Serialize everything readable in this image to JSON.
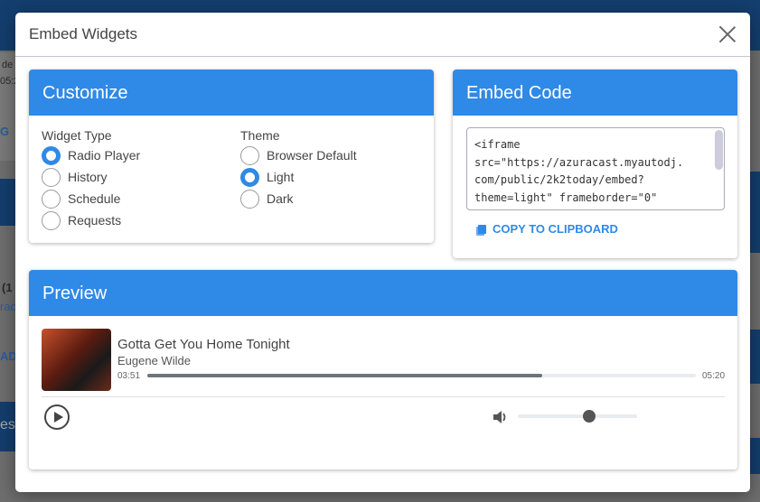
{
  "background": {
    "fragments": [
      "de",
      "05:2",
      "G",
      "(1",
      "rac",
      "AD",
      "es"
    ]
  },
  "modal": {
    "title": "Embed Widgets",
    "close_icon": "close-icon"
  },
  "customize": {
    "title": "Customize",
    "widget_type": {
      "label": "Widget Type",
      "options": [
        "Radio Player",
        "History",
        "Schedule",
        "Requests"
      ],
      "selected": "Radio Player"
    },
    "theme": {
      "label": "Theme",
      "options": [
        "Browser Default",
        "Light",
        "Dark"
      ],
      "selected": "Light"
    }
  },
  "embed": {
    "title": "Embed Code",
    "code": "<iframe\nsrc=\"https://azuracast.myautodj.\ncom/public/2k2today/embed?\ntheme=light\" frameborder=\"0\"",
    "copy_label": "COPY TO CLIPBOARD"
  },
  "preview": {
    "title": "Preview",
    "song": "Gotta Get You Home Tonight",
    "artist": "Eugene Wilde",
    "elapsed": "03:51",
    "duration": "05:20",
    "progress_percent": 72,
    "volume_percent": 60
  },
  "colors": {
    "accent": "#2f89e6"
  }
}
